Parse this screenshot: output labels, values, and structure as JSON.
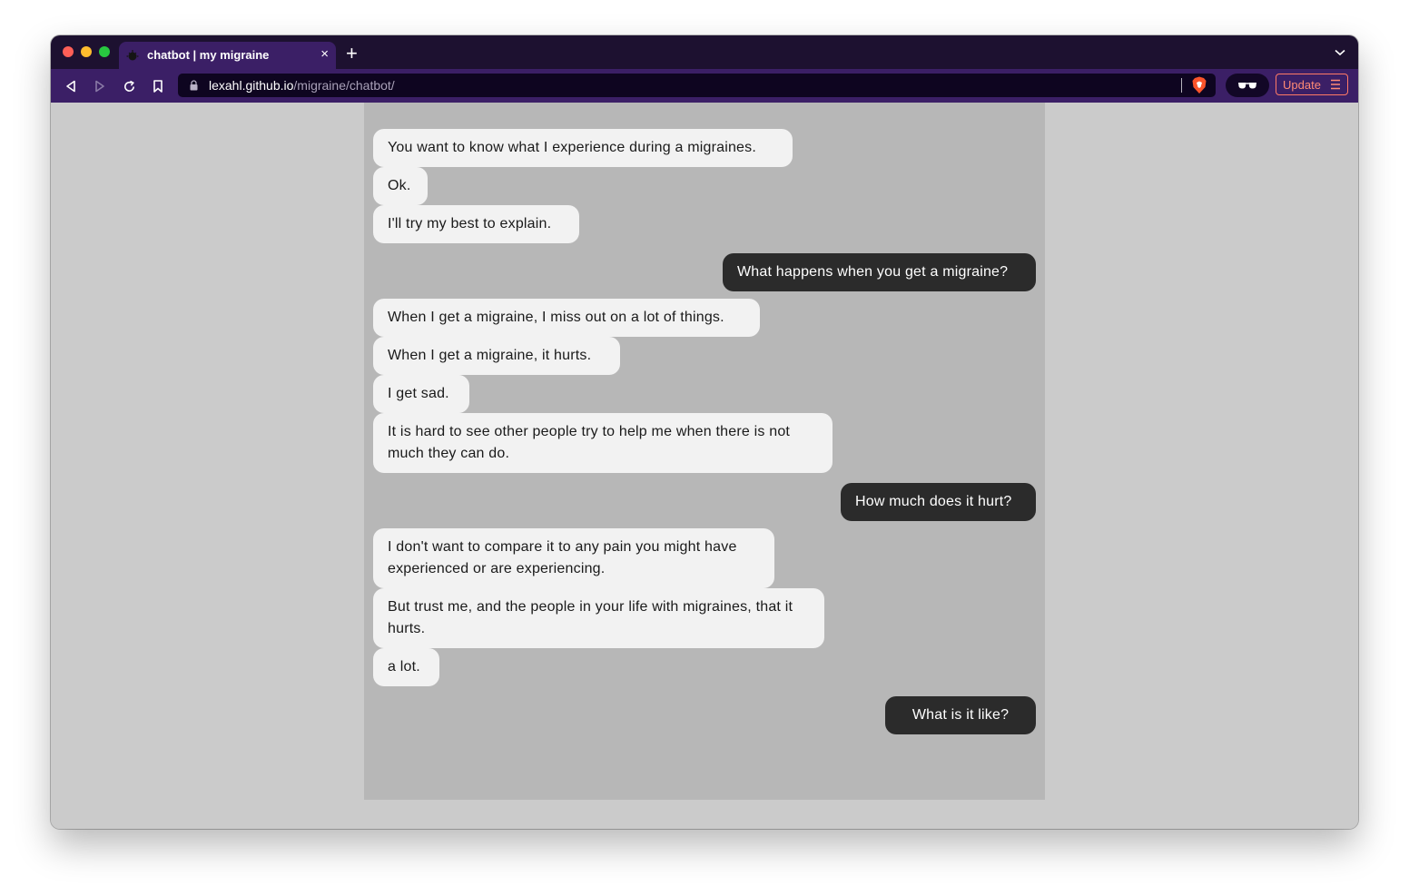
{
  "browser": {
    "tab_title": "chatbot | my migraine",
    "tab_close_label": "×",
    "new_tab_label": "+",
    "tab_menu_label": "⌄",
    "url_host": "lexahl.github.io",
    "url_path": "/migraine/chatbot/",
    "update_label": "Update",
    "icons": [
      "back-icon",
      "forward-icon",
      "reload-icon",
      "bookmark-icon",
      "lock-icon",
      "brave-shield-icon",
      "glasses-icon",
      "menu-icon"
    ]
  },
  "chat": {
    "messages": [
      {
        "role": "bot",
        "text": "You want to know what I experience during a migraines."
      },
      {
        "role": "bot",
        "text": "Ok."
      },
      {
        "role": "bot",
        "text": "I'll try my best to explain."
      },
      {
        "role": "user",
        "text": "What happens when you get a migraine?"
      },
      {
        "role": "bot",
        "text": "When I get a migraine, I miss out on a lot of things."
      },
      {
        "role": "bot",
        "text": "When I get a migraine, it hurts."
      },
      {
        "role": "bot",
        "text": "I get sad."
      },
      {
        "role": "bot",
        "text": "It is hard to see other people try to help me when there is not much they can do."
      },
      {
        "role": "user",
        "text": "How much does it hurt?"
      },
      {
        "role": "bot",
        "text": "I don't want to compare it to any pain you might have experienced or are experiencing."
      },
      {
        "role": "bot",
        "text": "But trust me, and the people in your life with migraines, that it hurts."
      },
      {
        "role": "bot",
        "text": "a lot."
      },
      {
        "role": "user",
        "text": "What is it like?"
      }
    ]
  },
  "colors": {
    "tab_strip": "#1d1130",
    "toolbar": "#3b1f66",
    "page_bg": "#cbcbcb",
    "chat_bg": "#b7b7b7",
    "bot_bubble": "#f2f2f2",
    "user_bubble": "#2b2b2b",
    "update_accent": "#ff7a66"
  }
}
